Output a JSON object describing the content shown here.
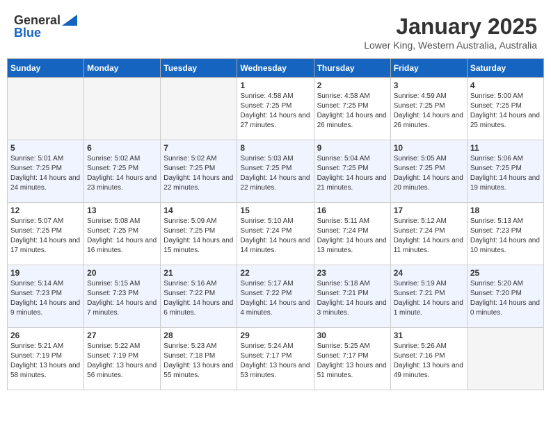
{
  "header": {
    "logo_line1": "General",
    "logo_line2": "Blue",
    "month": "January 2025",
    "location": "Lower King, Western Australia, Australia"
  },
  "weekdays": [
    "Sunday",
    "Monday",
    "Tuesday",
    "Wednesday",
    "Thursday",
    "Friday",
    "Saturday"
  ],
  "weeks": [
    [
      {
        "day": "",
        "sunrise": "",
        "sunset": "",
        "daylight": ""
      },
      {
        "day": "",
        "sunrise": "",
        "sunset": "",
        "daylight": ""
      },
      {
        "day": "",
        "sunrise": "",
        "sunset": "",
        "daylight": ""
      },
      {
        "day": "1",
        "sunrise": "Sunrise: 4:58 AM",
        "sunset": "Sunset: 7:25 PM",
        "daylight": "Daylight: 14 hours and 27 minutes."
      },
      {
        "day": "2",
        "sunrise": "Sunrise: 4:58 AM",
        "sunset": "Sunset: 7:25 PM",
        "daylight": "Daylight: 14 hours and 26 minutes."
      },
      {
        "day": "3",
        "sunrise": "Sunrise: 4:59 AM",
        "sunset": "Sunset: 7:25 PM",
        "daylight": "Daylight: 14 hours and 26 minutes."
      },
      {
        "day": "4",
        "sunrise": "Sunrise: 5:00 AM",
        "sunset": "Sunset: 7:25 PM",
        "daylight": "Daylight: 14 hours and 25 minutes."
      }
    ],
    [
      {
        "day": "5",
        "sunrise": "Sunrise: 5:01 AM",
        "sunset": "Sunset: 7:25 PM",
        "daylight": "Daylight: 14 hours and 24 minutes."
      },
      {
        "day": "6",
        "sunrise": "Sunrise: 5:02 AM",
        "sunset": "Sunset: 7:25 PM",
        "daylight": "Daylight: 14 hours and 23 minutes."
      },
      {
        "day": "7",
        "sunrise": "Sunrise: 5:02 AM",
        "sunset": "Sunset: 7:25 PM",
        "daylight": "Daylight: 14 hours and 22 minutes."
      },
      {
        "day": "8",
        "sunrise": "Sunrise: 5:03 AM",
        "sunset": "Sunset: 7:25 PM",
        "daylight": "Daylight: 14 hours and 22 minutes."
      },
      {
        "day": "9",
        "sunrise": "Sunrise: 5:04 AM",
        "sunset": "Sunset: 7:25 PM",
        "daylight": "Daylight: 14 hours and 21 minutes."
      },
      {
        "day": "10",
        "sunrise": "Sunrise: 5:05 AM",
        "sunset": "Sunset: 7:25 PM",
        "daylight": "Daylight: 14 hours and 20 minutes."
      },
      {
        "day": "11",
        "sunrise": "Sunrise: 5:06 AM",
        "sunset": "Sunset: 7:25 PM",
        "daylight": "Daylight: 14 hours and 19 minutes."
      }
    ],
    [
      {
        "day": "12",
        "sunrise": "Sunrise: 5:07 AM",
        "sunset": "Sunset: 7:25 PM",
        "daylight": "Daylight: 14 hours and 17 minutes."
      },
      {
        "day": "13",
        "sunrise": "Sunrise: 5:08 AM",
        "sunset": "Sunset: 7:25 PM",
        "daylight": "Daylight: 14 hours and 16 minutes."
      },
      {
        "day": "14",
        "sunrise": "Sunrise: 5:09 AM",
        "sunset": "Sunset: 7:25 PM",
        "daylight": "Daylight: 14 hours and 15 minutes."
      },
      {
        "day": "15",
        "sunrise": "Sunrise: 5:10 AM",
        "sunset": "Sunset: 7:24 PM",
        "daylight": "Daylight: 14 hours and 14 minutes."
      },
      {
        "day": "16",
        "sunrise": "Sunrise: 5:11 AM",
        "sunset": "Sunset: 7:24 PM",
        "daylight": "Daylight: 14 hours and 13 minutes."
      },
      {
        "day": "17",
        "sunrise": "Sunrise: 5:12 AM",
        "sunset": "Sunset: 7:24 PM",
        "daylight": "Daylight: 14 hours and 11 minutes."
      },
      {
        "day": "18",
        "sunrise": "Sunrise: 5:13 AM",
        "sunset": "Sunset: 7:23 PM",
        "daylight": "Daylight: 14 hours and 10 minutes."
      }
    ],
    [
      {
        "day": "19",
        "sunrise": "Sunrise: 5:14 AM",
        "sunset": "Sunset: 7:23 PM",
        "daylight": "Daylight: 14 hours and 9 minutes."
      },
      {
        "day": "20",
        "sunrise": "Sunrise: 5:15 AM",
        "sunset": "Sunset: 7:23 PM",
        "daylight": "Daylight: 14 hours and 7 minutes."
      },
      {
        "day": "21",
        "sunrise": "Sunrise: 5:16 AM",
        "sunset": "Sunset: 7:22 PM",
        "daylight": "Daylight: 14 hours and 6 minutes."
      },
      {
        "day": "22",
        "sunrise": "Sunrise: 5:17 AM",
        "sunset": "Sunset: 7:22 PM",
        "daylight": "Daylight: 14 hours and 4 minutes."
      },
      {
        "day": "23",
        "sunrise": "Sunrise: 5:18 AM",
        "sunset": "Sunset: 7:21 PM",
        "daylight": "Daylight: 14 hours and 3 minutes."
      },
      {
        "day": "24",
        "sunrise": "Sunrise: 5:19 AM",
        "sunset": "Sunset: 7:21 PM",
        "daylight": "Daylight: 14 hours and 1 minute."
      },
      {
        "day": "25",
        "sunrise": "Sunrise: 5:20 AM",
        "sunset": "Sunset: 7:20 PM",
        "daylight": "Daylight: 14 hours and 0 minutes."
      }
    ],
    [
      {
        "day": "26",
        "sunrise": "Sunrise: 5:21 AM",
        "sunset": "Sunset: 7:19 PM",
        "daylight": "Daylight: 13 hours and 58 minutes."
      },
      {
        "day": "27",
        "sunrise": "Sunrise: 5:22 AM",
        "sunset": "Sunset: 7:19 PM",
        "daylight": "Daylight: 13 hours and 56 minutes."
      },
      {
        "day": "28",
        "sunrise": "Sunrise: 5:23 AM",
        "sunset": "Sunset: 7:18 PM",
        "daylight": "Daylight: 13 hours and 55 minutes."
      },
      {
        "day": "29",
        "sunrise": "Sunrise: 5:24 AM",
        "sunset": "Sunset: 7:17 PM",
        "daylight": "Daylight: 13 hours and 53 minutes."
      },
      {
        "day": "30",
        "sunrise": "Sunrise: 5:25 AM",
        "sunset": "Sunset: 7:17 PM",
        "daylight": "Daylight: 13 hours and 51 minutes."
      },
      {
        "day": "31",
        "sunrise": "Sunrise: 5:26 AM",
        "sunset": "Sunset: 7:16 PM",
        "daylight": "Daylight: 13 hours and 49 minutes."
      },
      {
        "day": "",
        "sunrise": "",
        "sunset": "",
        "daylight": ""
      }
    ]
  ]
}
